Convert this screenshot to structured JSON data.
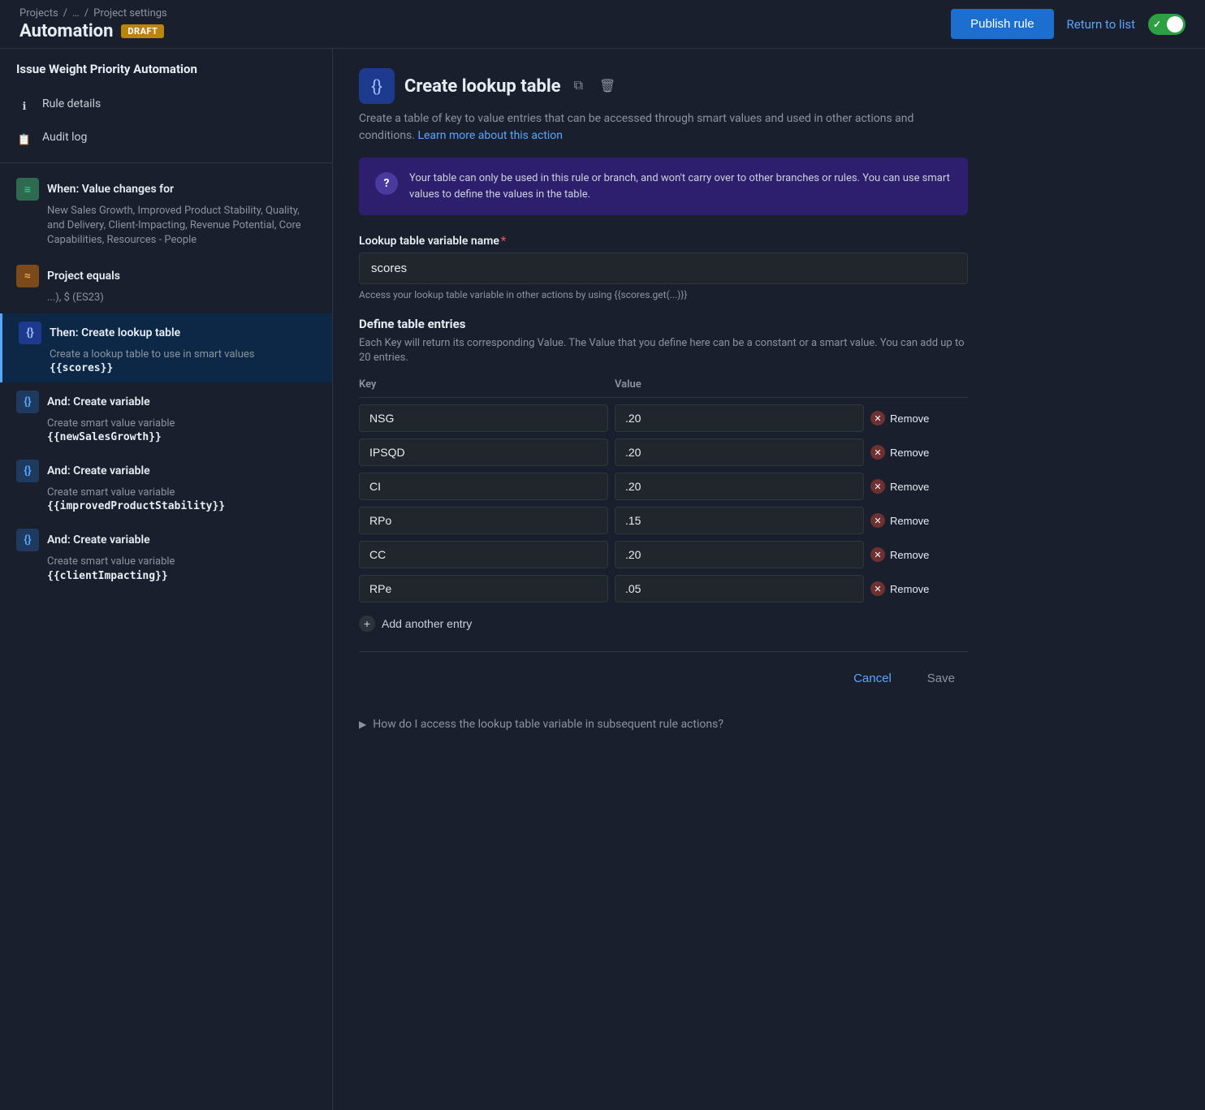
{
  "breadcrumb": {
    "projects": "Projects",
    "separator1": "/",
    "project": "...",
    "separator2": "/",
    "settings": "Project settings"
  },
  "header": {
    "title": "Automation",
    "badge": "DRAFT",
    "publish_label": "Publish rule",
    "return_label": "Return to list"
  },
  "sidebar": {
    "rule_title": "Issue Weight Priority Automation",
    "meta_items": [
      {
        "icon": "ℹ",
        "label": "Rule details"
      },
      {
        "icon": "📋",
        "label": "Audit log"
      }
    ],
    "workflow_items": [
      {
        "icon": "≡",
        "icon_class": "icon-green",
        "title": "When: Value changes for",
        "desc": "New Sales Growth, Improved Product Stability, Quality, and Delivery, Client-Impacting, Revenue Potential, Core Capabilities, Resources - People",
        "code": null,
        "active": false
      },
      {
        "icon": "≈",
        "icon_class": "icon-orange",
        "title": "Project equals",
        "desc": "...), $ (ES23)",
        "code": null,
        "active": false
      },
      {
        "icon": "{}",
        "icon_class": "icon-blue-active",
        "title": "Then: Create lookup table",
        "desc": "Create a lookup table to use in smart values",
        "code": "{{scores}}",
        "active": true
      },
      {
        "icon": "{}",
        "icon_class": "icon-blue",
        "title": "And: Create variable",
        "desc": "Create smart value variable",
        "code": "{{newSalesGrowth}}",
        "active": false
      },
      {
        "icon": "{}",
        "icon_class": "icon-blue",
        "title": "And: Create variable",
        "desc": "Create smart value variable",
        "code": "{{improvedProductStability}}",
        "active": false
      },
      {
        "icon": "{}",
        "icon_class": "icon-blue",
        "title": "And: Create variable",
        "desc": "Create smart value variable",
        "code": "{{clientImpacting}}",
        "active": false
      }
    ]
  },
  "content": {
    "title": "Create lookup table",
    "icon_label": "{}",
    "description": "Create a table of key to value entries that can be accessed through smart values and used in other actions and conditions.",
    "learn_more_label": "Learn more about this action",
    "info_text": "Your table can only be used in this rule or branch, and won't carry over to other branches or rules. You can use smart values to define the values in the table.",
    "form": {
      "variable_name_label": "Lookup table variable name",
      "variable_name_value": "scores",
      "variable_name_hint": "Access your lookup table variable in other actions by using {{scores.get(...)}}",
      "table_section_title": "Define table entries",
      "table_section_desc": "Each Key will return its corresponding Value. The Value that you define here can be a constant or a smart value. You can add up to 20 entries.",
      "col_key": "Key",
      "col_value": "Value",
      "entries": [
        {
          "key": "NSG",
          "value": ".20"
        },
        {
          "key": "IPSQD",
          "value": ".20"
        },
        {
          "key": "CI",
          "value": ".20"
        },
        {
          "key": "RPo",
          "value": ".15"
        },
        {
          "key": "CC",
          "value": ".20"
        },
        {
          "key": "RPe",
          "value": ".05"
        }
      ],
      "remove_label": "Remove",
      "add_entry_label": "Add another entry",
      "cancel_label": "Cancel",
      "save_label": "Save",
      "faq_label": "How do I access the lookup table variable in subsequent rule actions?"
    }
  }
}
